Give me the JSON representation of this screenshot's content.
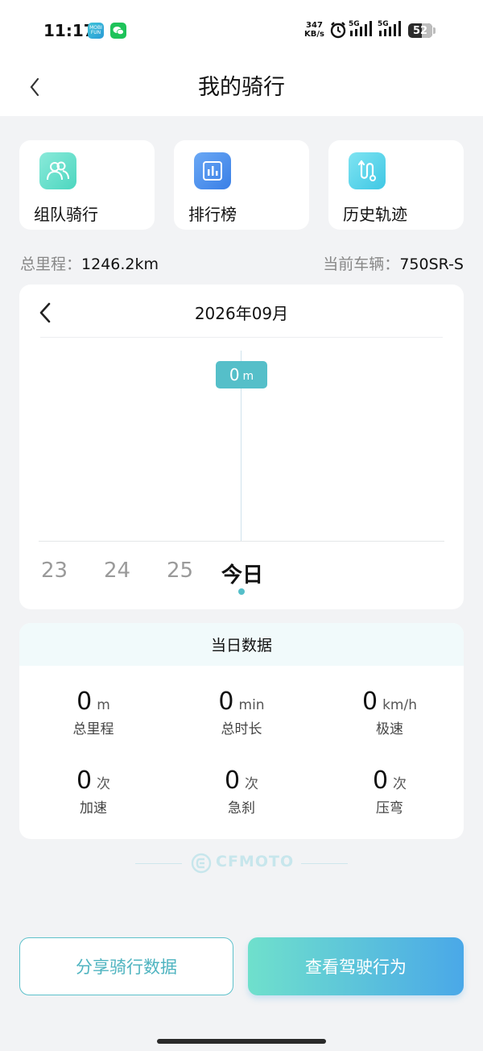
{
  "status_bar": {
    "time": "11:17",
    "app1": "MOBI FUN",
    "net_speed_value": "347",
    "net_speed_unit": "KB/s",
    "signal1": "5G",
    "signal2": "5G",
    "battery": "52",
    "battery_level_percent": 52
  },
  "header": {
    "title": "我的骑行"
  },
  "quick_actions": [
    {
      "label": "组队骑行",
      "icon": "team-ride-icon"
    },
    {
      "label": "排行榜",
      "icon": "leaderboard-icon"
    },
    {
      "label": "历史轨迹",
      "icon": "history-track-icon"
    }
  ],
  "summary": {
    "total_label": "总里程：",
    "total_value": "1246.2km",
    "vehicle_label": "当前车辆：",
    "vehicle_value": "750SR-S"
  },
  "chart": {
    "month": "2026年09月",
    "tooltip_value": "0",
    "tooltip_unit": "m",
    "days": [
      "23",
      "24",
      "25",
      "今日"
    ],
    "selected_day": "今日"
  },
  "day_data": {
    "title": "当日数据",
    "stats": [
      {
        "value": "0",
        "unit": "m",
        "label": "总里程"
      },
      {
        "value": "0",
        "unit": "min",
        "label": "总时长"
      },
      {
        "value": "0",
        "unit": "km/h",
        "label": "极速"
      },
      {
        "value": "0",
        "unit": "次",
        "label": "加速"
      },
      {
        "value": "0",
        "unit": "次",
        "label": "急刹"
      },
      {
        "value": "0",
        "unit": "次",
        "label": "压弯"
      }
    ]
  },
  "brand": {
    "logo_text": "CFMOTO"
  },
  "actions": {
    "share": "分享骑行数据",
    "behavior": "查看驾驶行为"
  },
  "colors": {
    "accent": "#55bfc9",
    "gradient_start": "#6fe0cc",
    "gradient_end": "#4aa8e8"
  }
}
